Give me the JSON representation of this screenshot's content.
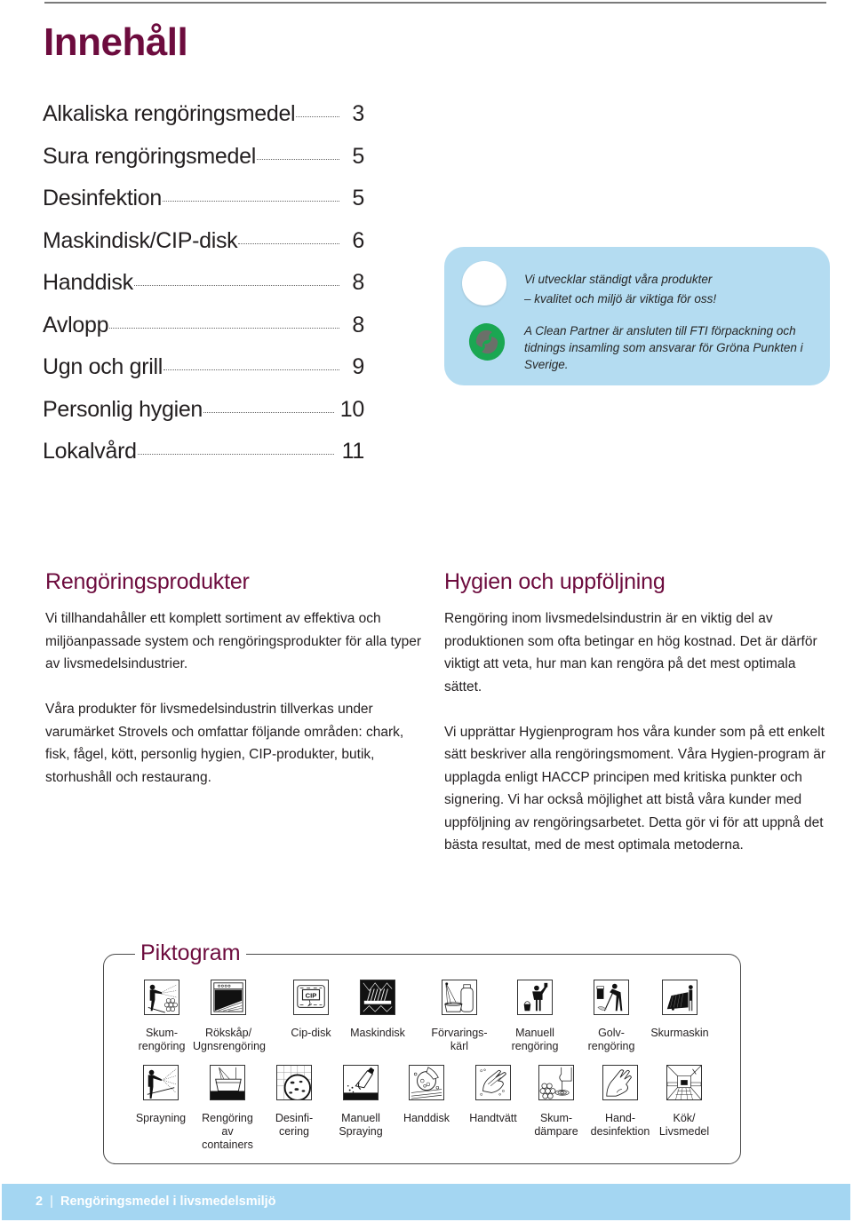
{
  "page_title": "Innehåll",
  "toc": [
    {
      "label": "Alkaliska rengöringsmedel",
      "page": "3"
    },
    {
      "label": "Sura rengöringsmedel",
      "page": "5"
    },
    {
      "label": "Desinfektion",
      "page": "5"
    },
    {
      "label": "Maskindisk/CIP-disk",
      "page": "6"
    },
    {
      "label": "Handdisk",
      "page": "8"
    },
    {
      "label": "Avlopp",
      "page": "8"
    },
    {
      "label": "Ugn och grill",
      "page": "9"
    },
    {
      "label": "Personlig hygien",
      "page": "10"
    },
    {
      "label": "Lokalvård",
      "page": "11"
    }
  ],
  "info_box": {
    "line1": "Vi utvecklar ständigt våra produkter",
    "line2": "– kvalitet och miljö är viktiga för oss!",
    "partner_text": "A Clean Partner är ansluten till FTI förpackning och tidnings insamling som ansvarar för Gröna Punkten i Sverige.",
    "logo_icon": "grona-punkten-recycling-icon",
    "colors": {
      "background": "#b4dcf1",
      "logo_green": "#1aa752",
      "logo_gray": "#6b7069"
    }
  },
  "sections": {
    "left": {
      "heading": "Rengöringsprodukter",
      "paragraphs": [
        "Vi tillhandahåller ett komplett sortiment av effektiva och miljöanpassade system och rengöringsprodukter för alla typer av livsmedelsindustrier.",
        "Våra produkter för livsmedelsindustrin tillverkas under varumärket Strovels och omfattar följande områden: chark, fisk, fågel, kött, personlig hygien, CIP-produkter, butik, storhushåll och restaurang."
      ]
    },
    "right": {
      "heading": "Hygien och uppföljning",
      "paragraphs": [
        "Rengöring inom livsmedelsindustrin är en viktig del av produktionen som ofta betingar en hög kostnad. Det är därför viktigt att veta, hur man kan rengöra på det mest optimala sättet.",
        "Vi upprättar Hygienprogram hos våra kunder som på ett enkelt sätt beskriver alla rengöringsmoment. Våra Hygien-program är upplagda enligt HACCP principen med kritiska punkter och signering. Vi har också möjlighet att bistå våra kunder med uppföljning av rengöringsarbetet. Detta gör vi för att uppnå det bästa resultat, med de mest optimala metoderna."
      ]
    }
  },
  "piktogram": {
    "title": "Piktogram",
    "row1": [
      {
        "label": "Skum-\nrengöring",
        "icon": "foam-cleaning-icon"
      },
      {
        "label": "Rökskåp/\nUgnsrengöring",
        "icon": "oven-cleaning-icon"
      },
      {
        "label": "Cip-disk",
        "icon": "cip-icon",
        "icon_text": "CIP"
      },
      {
        "label": "Maskindisk",
        "icon": "dishwasher-icon"
      },
      {
        "label": "Förvarings-\nkärl",
        "icon": "storage-container-icon"
      },
      {
        "label": "Manuell\nrengöring",
        "icon": "manual-cleaning-icon"
      },
      {
        "label": "Golv-\nrengöring",
        "icon": "floor-cleaning-icon"
      },
      {
        "label": "Skurmaskin",
        "icon": "scrubber-machine-icon"
      }
    ],
    "row2": [
      {
        "label": "Sprayning",
        "icon": "spraying-icon"
      },
      {
        "label": "Rengöring\nav\ncontainers",
        "icon": "container-cleaning-icon"
      },
      {
        "label": "Desinfi-\ncering",
        "icon": "disinfection-icon"
      },
      {
        "label": "Manuell\nSpraying",
        "icon": "manual-spray-bottle-icon"
      },
      {
        "label": "Handdisk",
        "icon": "hand-dishwashing-icon"
      },
      {
        "label": "Handtvätt",
        "icon": "hand-washing-icon"
      },
      {
        "label": "Skum-\ndämpare",
        "icon": "foam-suppressor-icon"
      },
      {
        "label": "Hand-\ndesinfektion",
        "icon": "hand-disinfection-icon"
      },
      {
        "label": "Kök/\nLivsmedel",
        "icon": "kitchen-food-icon"
      }
    ]
  },
  "footer": {
    "page_number": "2",
    "separator": "|",
    "title": "Rengöringsmedel i livsmedelsmiljö",
    "bar_color": "#a4d6f2"
  },
  "colors": {
    "heading": "#6d0c3e",
    "body_text": "#231f20"
  }
}
